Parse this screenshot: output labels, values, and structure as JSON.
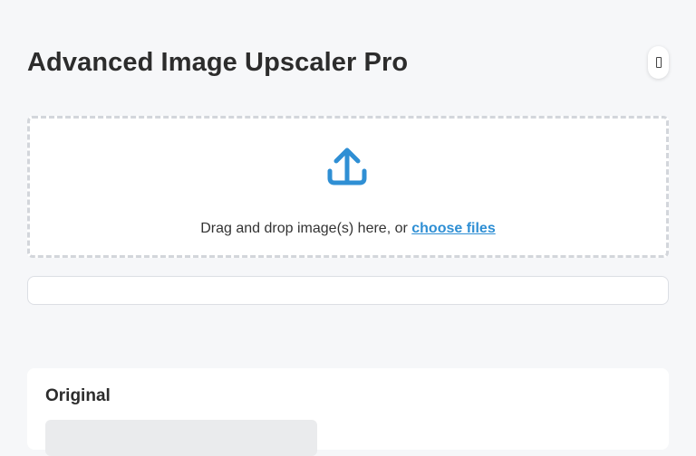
{
  "header": {
    "title": "Advanced Image Upscaler Pro",
    "theme_toggle_icon": "contrast-toggle-icon"
  },
  "dropzone": {
    "icon": "upload-icon",
    "icon_color": "#2f8fd4",
    "text": "Drag and drop image(s) here, or ",
    "link_label": "choose files"
  },
  "progress": {
    "value": 0
  },
  "preview": {
    "original_title": "Original"
  },
  "colors": {
    "accent": "#2f8fd4",
    "background": "#f6f7f9"
  }
}
